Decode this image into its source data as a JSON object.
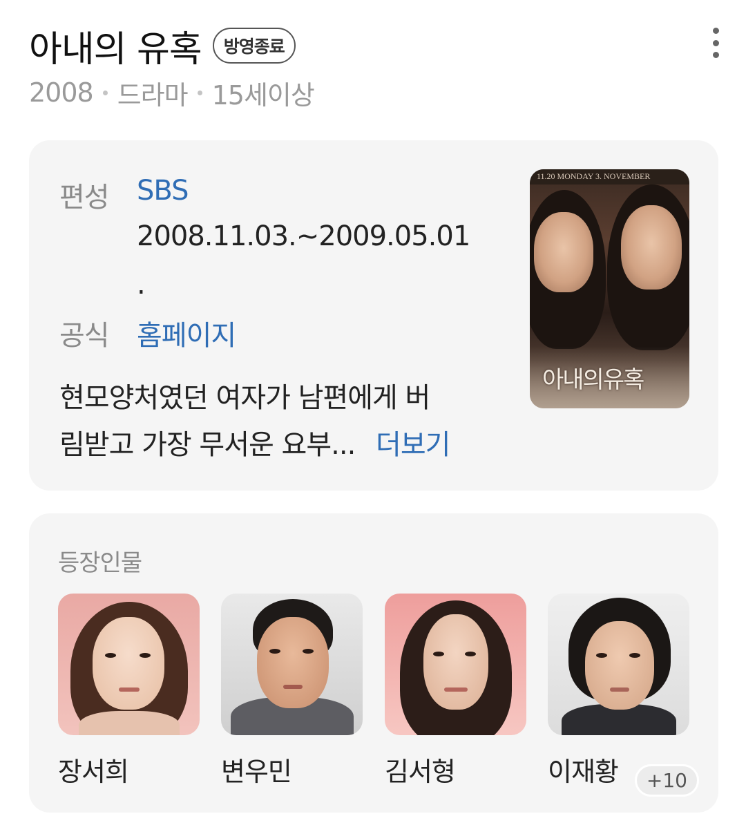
{
  "header": {
    "title": "아내의 유혹",
    "status_badge": "방영종료",
    "year": "2008",
    "genre": "드라마",
    "rating": "15세이상",
    "more_icon": "more-vertical-icon"
  },
  "info": {
    "broadcast_label": "편성",
    "broadcast_value": "SBS",
    "air_dates": "2008.11.03.~2009.05.01",
    "air_dates_trailing": ".",
    "official_label": "공식",
    "official_value": "홈페이지",
    "description_line1": "현모양처였던 여자가 남편에게 버",
    "description_line2": "림받고 가장 무서운 요부...",
    "more_link": "더보기",
    "poster_title": "아내의유혹",
    "poster_caption": "11.20 MONDAY 3. NOVEMBER"
  },
  "cast": {
    "heading": "등장인물",
    "items": [
      {
        "name": "장서희"
      },
      {
        "name": "변우민"
      },
      {
        "name": "김서형"
      },
      {
        "name": "이재황"
      }
    ],
    "more_count": "+10"
  },
  "colors": {
    "accent_link": "#2f6db5",
    "card_background": "#f5f5f5",
    "muted_text": "#8a8a8a"
  }
}
